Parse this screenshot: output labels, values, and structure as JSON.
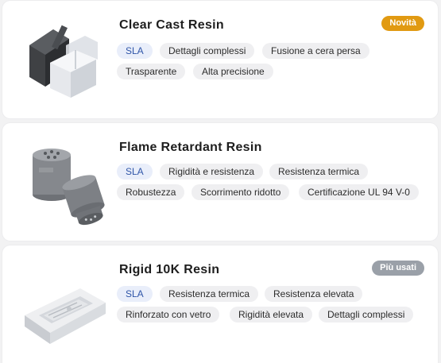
{
  "colors": {
    "badge_new": "#e19a12",
    "badge_popular": "#9aa0a8",
    "tech_tag_text": "#2f55a8"
  },
  "materials": [
    {
      "name": "Clear Cast Resin",
      "badge": "Novità",
      "image_icon": "clear-cast-parts-image",
      "tags": [
        "SLA",
        "Dettagli complessi",
        "Fusione a cera persa",
        "Trasparente",
        "Alta precisione"
      ]
    },
    {
      "name": "Flame Retardant Resin",
      "badge": "",
      "image_icon": "flame-retardant-parts-image",
      "tags": [
        "SLA",
        "Rigidità e resistenza",
        "Resistenza termica",
        "Robustezza",
        "Scorrimento ridotto",
        "Certificazione UL 94 V-0"
      ]
    },
    {
      "name": "Rigid 10K Resin",
      "badge": "Più usati",
      "image_icon": "rigid-mold-part-image",
      "tags": [
        "SLA",
        "Resistenza termica",
        "Resistenza elevata",
        "Rinforzato con vetro",
        "Rigidità elevata",
        "Dettagli complessi"
      ]
    }
  ]
}
